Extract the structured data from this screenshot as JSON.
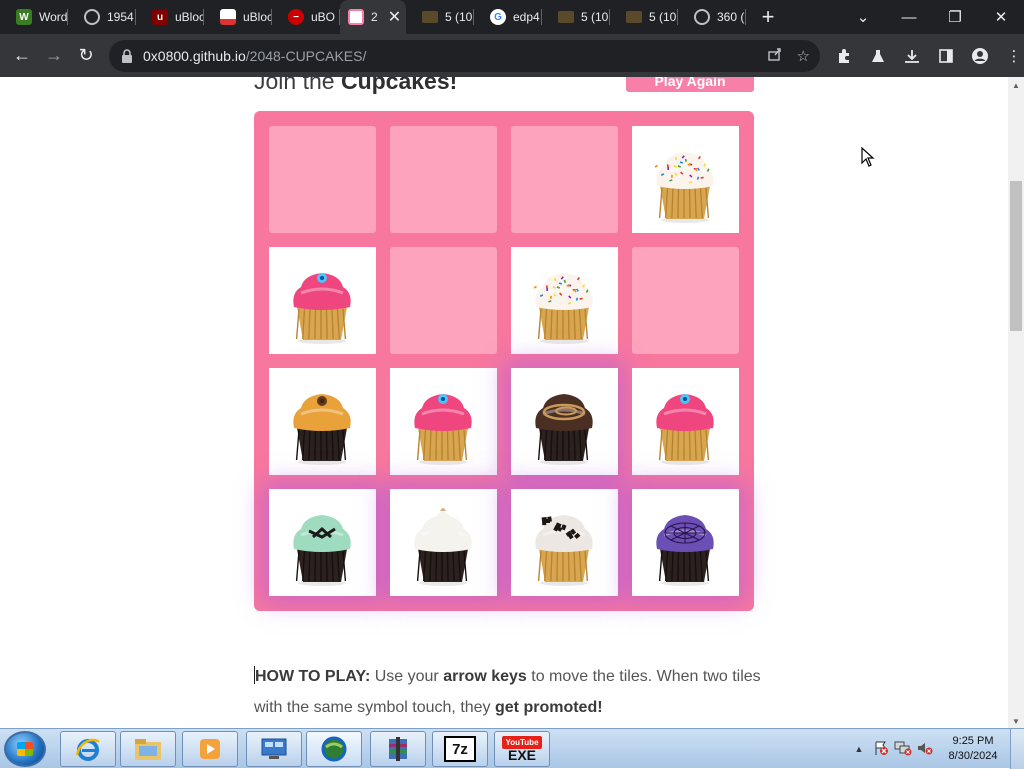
{
  "browser": {
    "tabs": [
      {
        "label": "Word",
        "icon": "word-icon",
        "color": "#3b7d23"
      },
      {
        "label": "1954",
        "icon": "globe-icon",
        "color": "#5f6368"
      },
      {
        "label": "uBloc",
        "icon": "ublock-icon",
        "color": "#800000"
      },
      {
        "label": "uBloc",
        "icon": "image-icon",
        "color": "#d33"
      },
      {
        "label": "uBO",
        "icon": "ublock-blocked-icon",
        "color": "#c00"
      },
      {
        "label": "2",
        "icon": "cupcakes-favicon",
        "color": "#f77fa8",
        "active": true
      },
      {
        "label": "5 (10",
        "icon": "folder-icon",
        "color": "#8a6d3b"
      },
      {
        "label": "edp4",
        "icon": "google-icon",
        "color": "#4285f4"
      },
      {
        "label": "5 (10",
        "icon": "folder-icon",
        "color": "#8a6d3b"
      },
      {
        "label": "5 (10",
        "icon": "folder-icon",
        "color": "#8a6d3b"
      },
      {
        "label": "360 (",
        "icon": "globe-icon",
        "color": "#5f6368"
      }
    ],
    "new_tab": "+",
    "url_host": "0x0800.github.io",
    "url_path": "/2048-CUPCAKES/"
  },
  "page": {
    "heading_prefix": "Join the ",
    "heading_bold": "Cupcakes!",
    "play_again": "Play Again",
    "board": [
      [
        "empty",
        "empty",
        "empty",
        "vanilla-sprinkles"
      ],
      [
        "pink-frosted",
        "empty",
        "vanilla-sprinkles",
        "empty"
      ],
      [
        "caramel",
        "pink-frosted",
        "chocolate-swirl",
        "pink-frosted"
      ],
      [
        "mint-chocolate",
        "meringue",
        "cookies-and-cream",
        "purple-web"
      ]
    ],
    "howto_label": "HOW TO PLAY:",
    "howto_1": " Use your ",
    "howto_keys": "arrow keys",
    "howto_2": " to move the tiles. When two tiles with the same symbol touch, they ",
    "howto_promoted": "get promoted!"
  },
  "taskbar": {
    "items": [
      "ie-icon",
      "explorer-icon",
      "media-player-icon",
      "network-icon",
      "globe-app-icon",
      "winrar-icon",
      "7z-icon",
      "youtube-exe-icon"
    ],
    "sevenzip_label": "7z",
    "exe_label": "EXE",
    "time": "9:25 PM",
    "date": "8/30/2024"
  },
  "colors": {
    "board": "#f7779f",
    "empty_cell": "#fda3bd",
    "accent": "#f77fa8"
  }
}
